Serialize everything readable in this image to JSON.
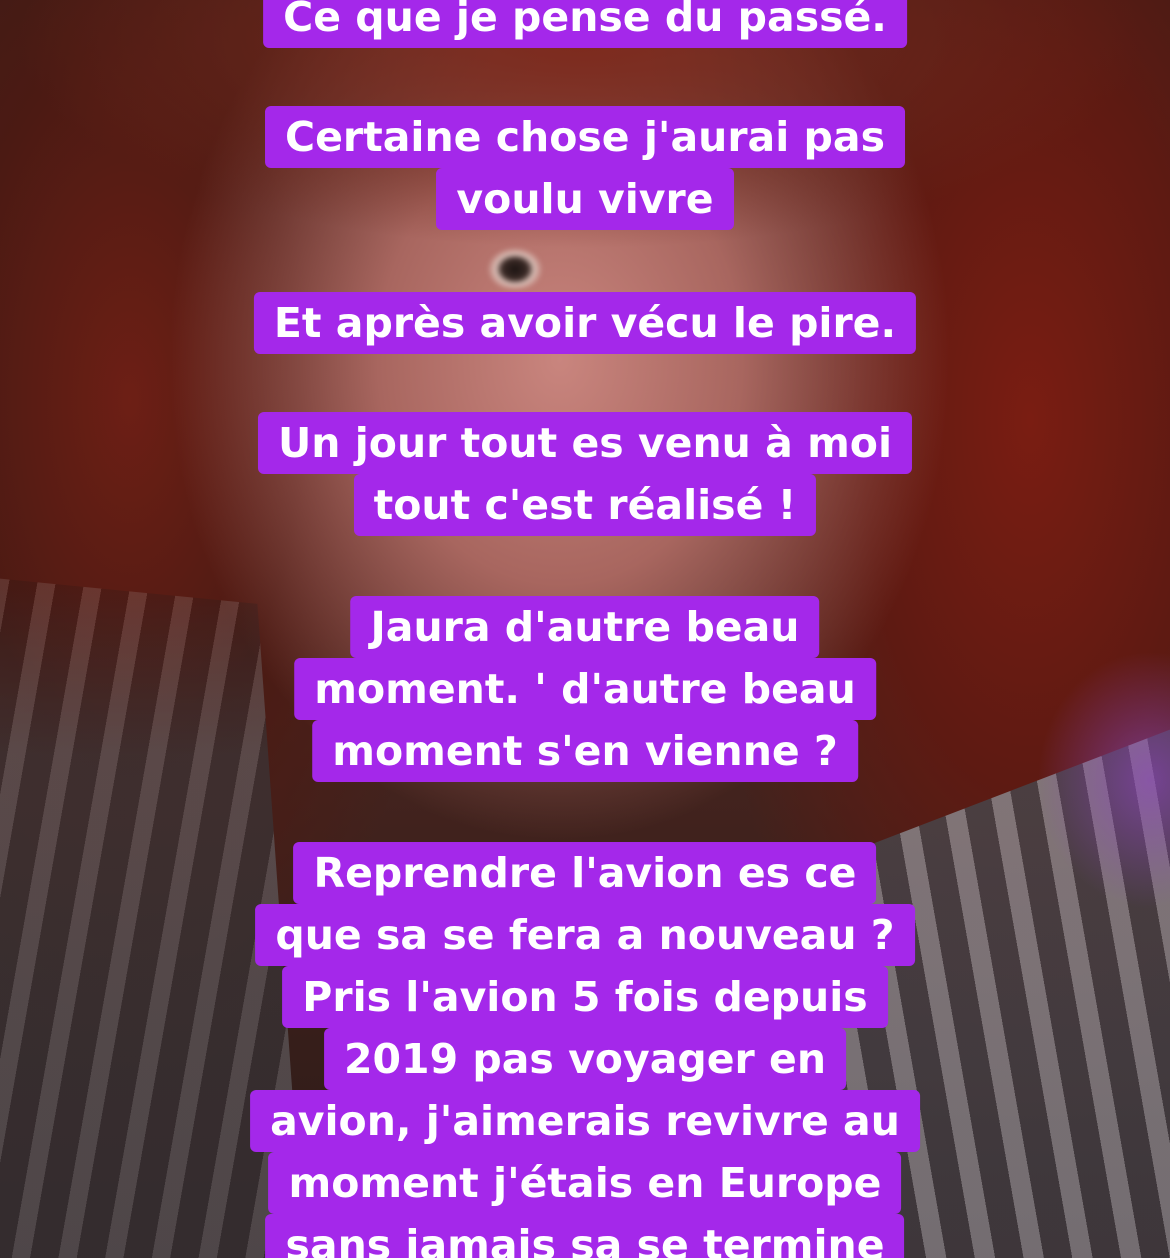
{
  "captions": [
    {
      "lines": [
        "Ce que je pense du passé."
      ]
    },
    {
      "lines": [
        "Certaine chose j'aurai pas",
        "voulu vivre"
      ]
    },
    {
      "lines": [
        "Et après avoir vécu le pire."
      ]
    },
    {
      "lines": [
        "Un jour tout es venu à moi",
        "tout c'est réalisé !"
      ]
    },
    {
      "lines": [
        "Jaura d'autre beau",
        "moment. ' d'autre beau",
        "moment s'en vienne ?"
      ]
    },
    {
      "lines": [
        "Reprendre l'avion es ce",
        "que sa se fera a nouveau ?",
        "Pris l'avion 5 fois depuis",
        "2019 pas voyager en",
        "avion, j'aimerais revivre au",
        "moment j'étais en Europe",
        "sans jamais sa se termine"
      ]
    }
  ],
  "colors": {
    "caption_background": "#a428ea",
    "caption_text": "#ffffff"
  }
}
